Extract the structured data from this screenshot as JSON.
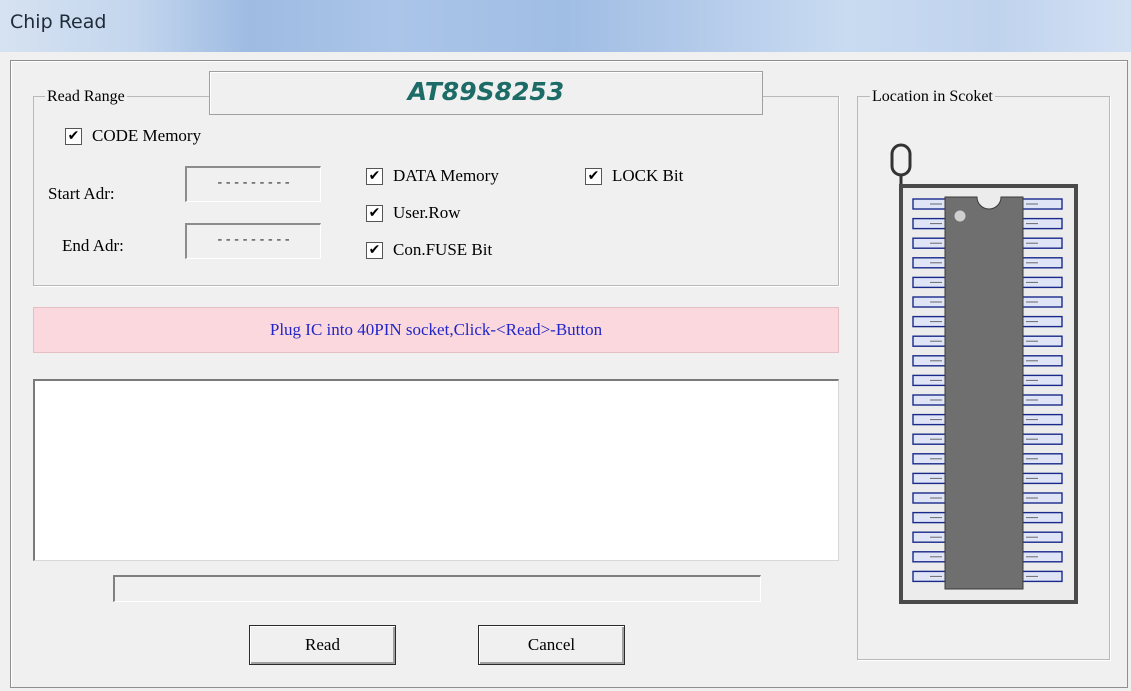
{
  "window": {
    "title": "Chip Read"
  },
  "read_range": {
    "legend": "Read Range",
    "chip_name": "AT89S8253",
    "code_memory": {
      "label": "CODE Memory",
      "checked": true
    },
    "start_adr": {
      "label": "Start Adr:",
      "value": "---------"
    },
    "end_adr": {
      "label": "End Adr:",
      "value": "---------"
    },
    "data_memory": {
      "label": "DATA Memory",
      "checked": true
    },
    "user_row": {
      "label": "User.Row",
      "checked": true
    },
    "con_fuse_bit": {
      "label": "Con.FUSE Bit",
      "checked": true
    },
    "lock_bit": {
      "label": "LOCK Bit",
      "checked": true
    }
  },
  "status": {
    "message": "Plug IC into 40PIN socket,Click-<Read>-Button"
  },
  "log": {
    "text": ""
  },
  "progress": {
    "fraction": 0
  },
  "buttons": {
    "read": "Read",
    "cancel": "Cancel"
  },
  "socket": {
    "legend": "Location in Scoket",
    "pins_per_side": 20
  },
  "colors": {
    "chip_name": "#1d6b66",
    "status_bg": "#fbd8dd",
    "status_text": "#2226c8",
    "chip_body": "#6f6f6f"
  }
}
